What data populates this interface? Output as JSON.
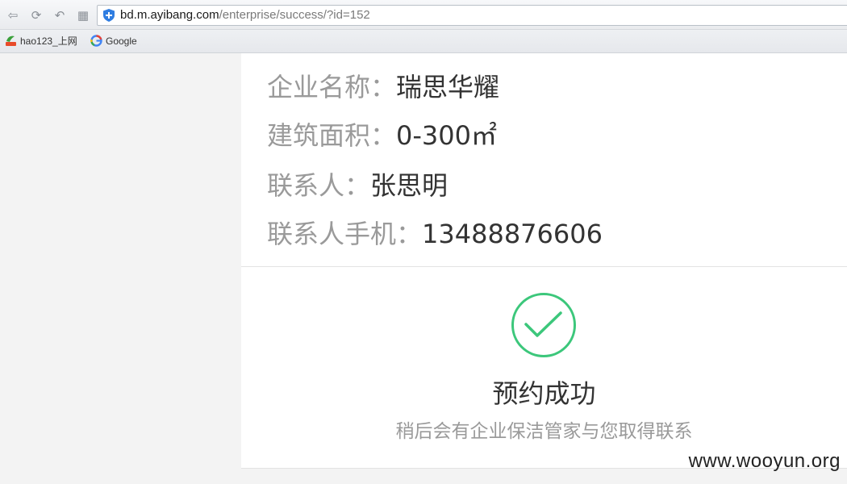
{
  "browser": {
    "url_host": "bd.m.ayibang.com",
    "url_path": "/enterprise/success/?id=152",
    "bookmarks": [
      {
        "label": "hao123_上网",
        "icon": "hao123-icon"
      },
      {
        "label": "Google",
        "icon": "google-icon"
      }
    ]
  },
  "info": {
    "company_label": "企业名称：",
    "company_value": "瑞思华耀",
    "area_label": "建筑面积：",
    "area_value": "0-300㎡",
    "contact_label": "联系人：",
    "contact_value": "张思明",
    "phone_label": "联系人手机：",
    "phone_value": "13488876606"
  },
  "success": {
    "title": "预约成功",
    "subtitle": "稍后会有企业保洁管家与您取得联系",
    "accent_color": "#3cc77b"
  },
  "watermark": "www.wooyun.org"
}
